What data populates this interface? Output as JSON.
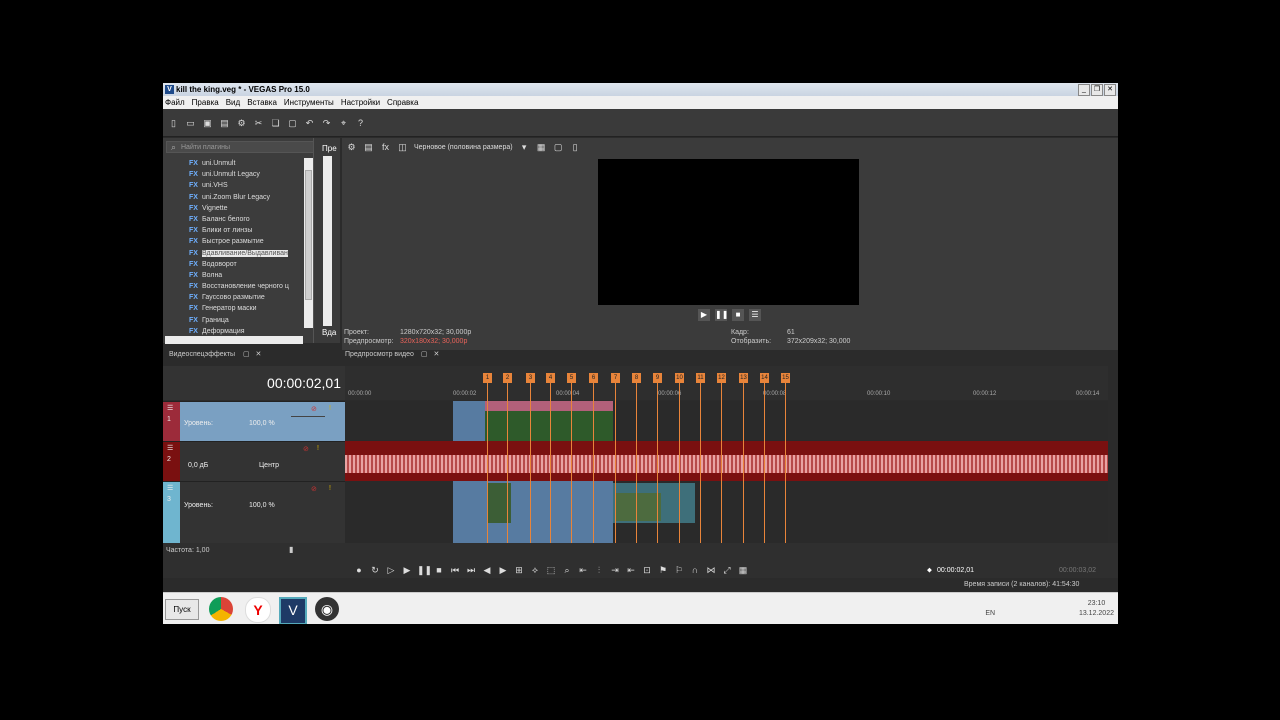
{
  "window": {
    "title": "kill the king.veg * - VEGAS Pro 15.0",
    "app_icon": "V"
  },
  "menu": [
    "Файл",
    "Правка",
    "Вид",
    "Вставка",
    "Инструменты",
    "Настройки",
    "Справка"
  ],
  "plugins": {
    "search_placeholder": "Найти плагины",
    "items": [
      "uni.Unmult",
      "uni.Unmult Legacy",
      "uni.VHS",
      "uni.Zoom Blur Legacy",
      "Vignette",
      "Баланс белого",
      "Блики от линзы",
      "Быстрое размытие",
      "Вдавливание/Выдавливан",
      "Водоворот",
      "Волна",
      "Восстановление черного ц",
      "Гауссово размытие",
      "Генератор маски",
      "Граница",
      "Деформация"
    ],
    "selected_index": 8,
    "fx_badge": "FX",
    "presets_label": "Пре",
    "presets_label2": "Вда",
    "tab_label": "Видеоспецэффекты"
  },
  "preview": {
    "quality_label": "Черновое (половина размера)",
    "tab_label": "Предпросмотр видео",
    "project_key": "Проект:",
    "project_val": "1280x720x32; 30,000p",
    "preview_key": "Предпросмотр:",
    "preview_val": "320x180x32; 30,000p",
    "frame_key": "Кадр:",
    "frame_val": "61",
    "display_key": "Отобразить:",
    "display_val": "372x209x32; 30,000"
  },
  "timeline": {
    "timecode": "00:00:02,01",
    "ruler_ticks": [
      "00:00:00",
      "00:00:02",
      "00:00:04",
      "00:00:06",
      "00:00:08",
      "00:00:10",
      "00:00:12",
      "00:00:14"
    ],
    "track1": {
      "number": "1",
      "level_label": "Уровень:",
      "level_value": "100,0 %"
    },
    "track2": {
      "number": "2",
      "vol_value": "0,0 дБ",
      "pan_label": "Центр"
    },
    "track3": {
      "number": "3",
      "level_label": "Уровень:",
      "level_value": "100,0 %"
    },
    "rate_label": "Частота: 1,00",
    "cursor_time": "00:00:02,01",
    "end_time": "00:00:03,02",
    "marker_labels": [
      "1",
      "2",
      "3",
      "4",
      "5",
      "6",
      "7",
      "8",
      "9",
      "10",
      "11",
      "12",
      "13",
      "14",
      "15"
    ]
  },
  "status": {
    "record_time": "Время записи (2 каналов): 41:54:30"
  },
  "taskbar": {
    "start_label": "Пуск",
    "lang": "EN",
    "time": "23:10",
    "date": "13.12.2022"
  }
}
